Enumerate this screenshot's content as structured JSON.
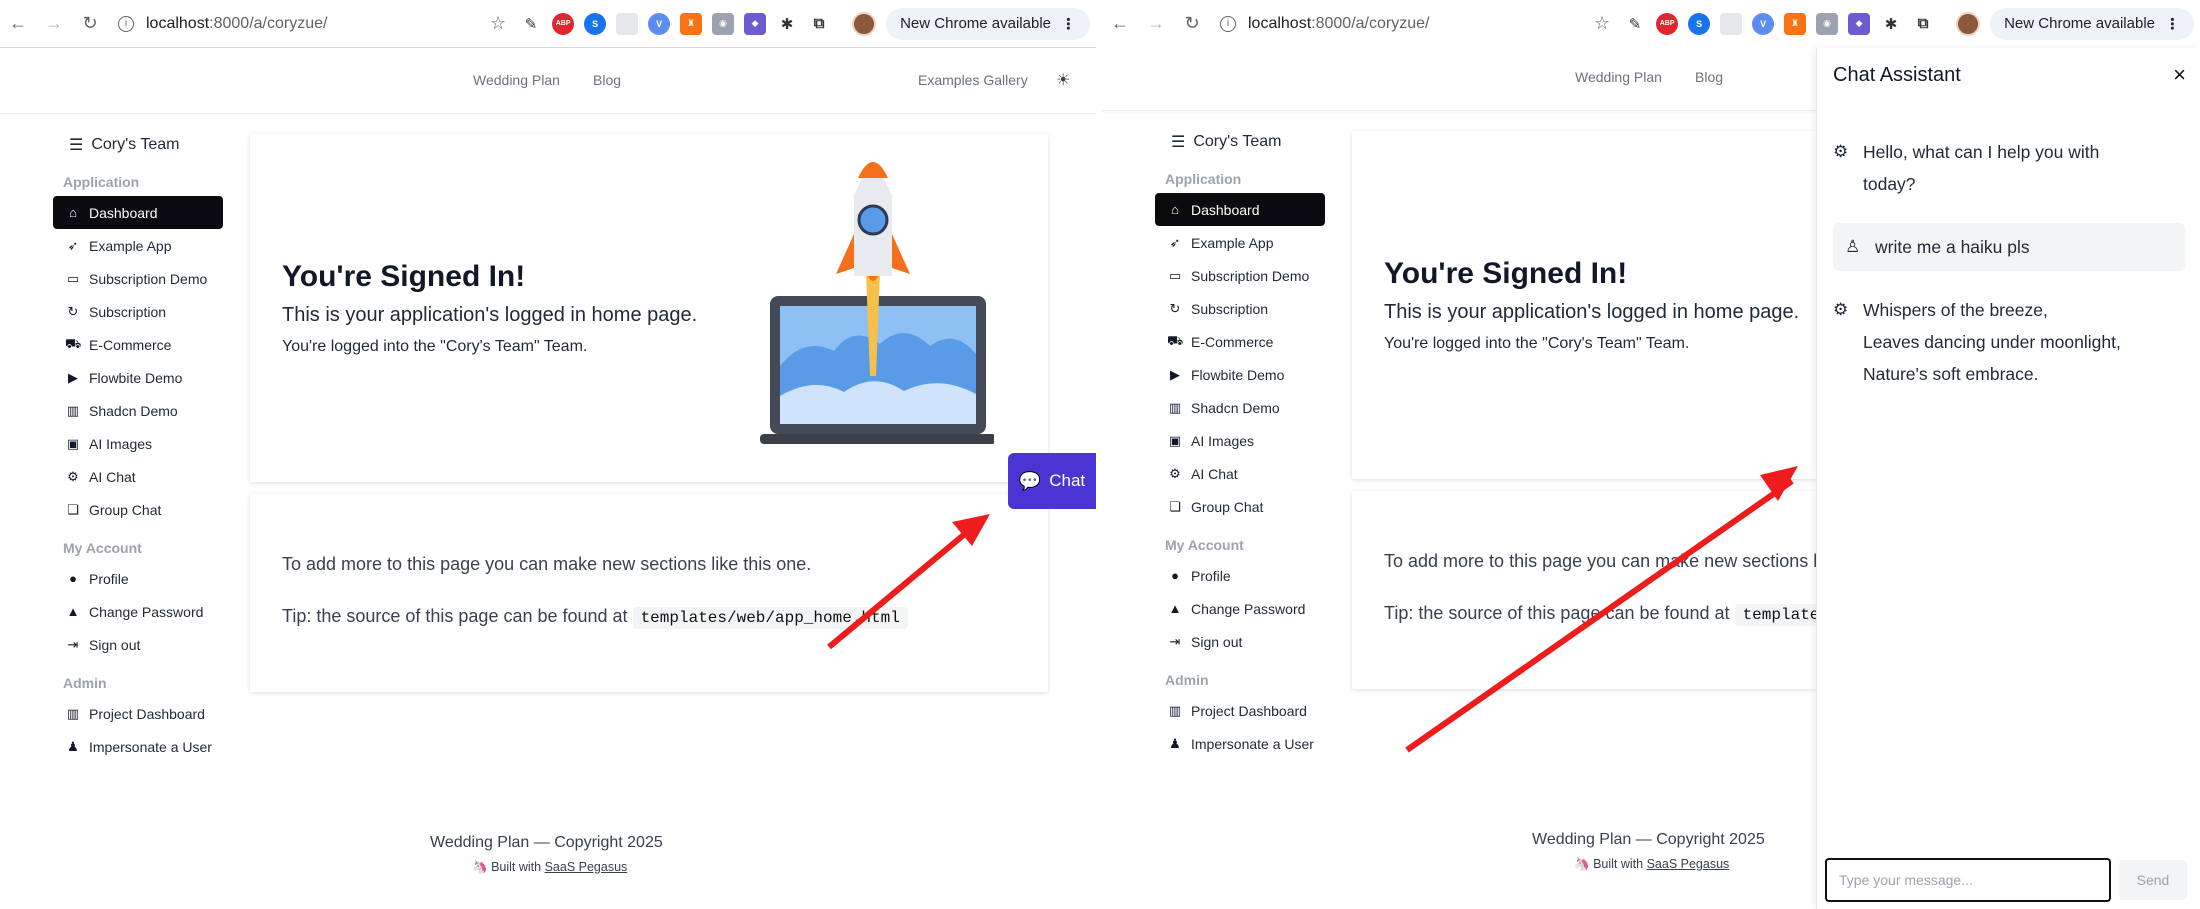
{
  "browser": {
    "url_host": "localhost",
    "url_path": ":8000/a/coryzue/",
    "update_label": "New Chrome available",
    "extensions": [
      "pen-icon",
      "abp-icon",
      "s-icon",
      "blank-icon",
      "v-icon",
      "orange-icon",
      "camera-icon",
      "purple-icon",
      "bug-icon",
      "puzzle-icon"
    ],
    "abp_label": "ABP"
  },
  "nav": {
    "wedding_plan": "Wedding Plan",
    "blog": "Blog",
    "examples_gallery": "Examples Gallery"
  },
  "sidebar": {
    "team_name": "Cory's Team",
    "section_application": "Application",
    "section_account": "My Account",
    "section_admin": "Admin",
    "application_items": [
      {
        "label": "Dashboard",
        "icon": "home-icon"
      },
      {
        "label": "Example App",
        "icon": "rocket-icon"
      },
      {
        "label": "Subscription Demo",
        "icon": "monitor-icon"
      },
      {
        "label": "Subscription",
        "icon": "refresh-icon"
      },
      {
        "label": "E-Commerce",
        "icon": "cart-icon"
      },
      {
        "label": "Flowbite Demo",
        "icon": "play-icon"
      },
      {
        "label": "Shadcn Demo",
        "icon": "chart-icon"
      },
      {
        "label": "AI Images",
        "icon": "image-icon"
      },
      {
        "label": "AI Chat",
        "icon": "robot-icon"
      },
      {
        "label": "Group Chat",
        "icon": "chat-bubbles-icon"
      }
    ],
    "account_items": [
      {
        "label": "Profile",
        "icon": "user-icon"
      },
      {
        "label": "Change Password",
        "icon": "lock-icon"
      },
      {
        "label": "Sign out",
        "icon": "sign-out-icon"
      }
    ],
    "admin_items": [
      {
        "label": "Project Dashboard",
        "icon": "chart-icon"
      },
      {
        "label": "Impersonate a User",
        "icon": "spy-icon"
      }
    ]
  },
  "hero": {
    "title": "You're Signed In!",
    "subtitle": "This is your application's logged in home page.",
    "team_note": "You're logged into the \"Cory's Team\" Team."
  },
  "info": {
    "line1": "To add more to this page you can make new sections like this one.",
    "tip_prefix": "Tip: the source of this page can be found at",
    "tip_path": "templates/web/app_home.html"
  },
  "footer": {
    "copyright": "Wedding Plan — Copyright 2025",
    "built_with": "Built with",
    "built_link": "SaaS Pegasus"
  },
  "chat_button": {
    "label": "Chat"
  },
  "chat_panel": {
    "title": "Chat Assistant",
    "close": "×",
    "messages": [
      {
        "role": "assistant",
        "lines": [
          "Hello, what can I help you with",
          "today?"
        ]
      },
      {
        "role": "user",
        "lines": [
          "write me a haiku pls"
        ]
      },
      {
        "role": "assistant",
        "lines": [
          "Whispers of the breeze,",
          "Leaves dancing under moonlight,",
          "Nature's soft embrace."
        ]
      }
    ],
    "input_placeholder": "Type your message...",
    "send_label": "Send"
  },
  "colors": {
    "active_item_bg": "#0b0b0f",
    "chat_button_bg": "#4a35d4",
    "annotation_arrow": "#ee1c1c"
  }
}
